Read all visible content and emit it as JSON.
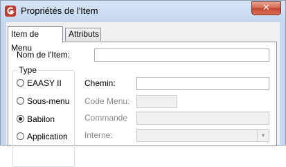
{
  "window": {
    "title": "Propriétés de l'Item",
    "close_glyph": "✕"
  },
  "tabs": [
    {
      "label": "Item de Menu",
      "active": true
    },
    {
      "label": "Attributs",
      "active": false
    }
  ],
  "form": {
    "nom_label": "Nom de l'Item:",
    "nom_value": "",
    "type_group_title": "Type",
    "type_options": [
      {
        "label": "EAASY II",
        "selected": false
      },
      {
        "label": "Sous-menu",
        "selected": false
      },
      {
        "label": "Babilon",
        "selected": true
      },
      {
        "label": "Application",
        "selected": false
      }
    ],
    "chemin_label": "Chemin:",
    "chemin_value": "",
    "code_menu_label": "Code Menu:",
    "code_menu_value": "",
    "commande_label": "Commande",
    "commande_value": "",
    "interne_label": "Interne:",
    "interne_value": ""
  },
  "icons": {
    "app": "app-logo-icon",
    "close": "close-icon",
    "combo": "chevron-down-icon"
  },
  "colors": {
    "titlebar": "#c6d7ee",
    "close_button": "#c2452c",
    "disabled_text": "#8a8a8a"
  }
}
